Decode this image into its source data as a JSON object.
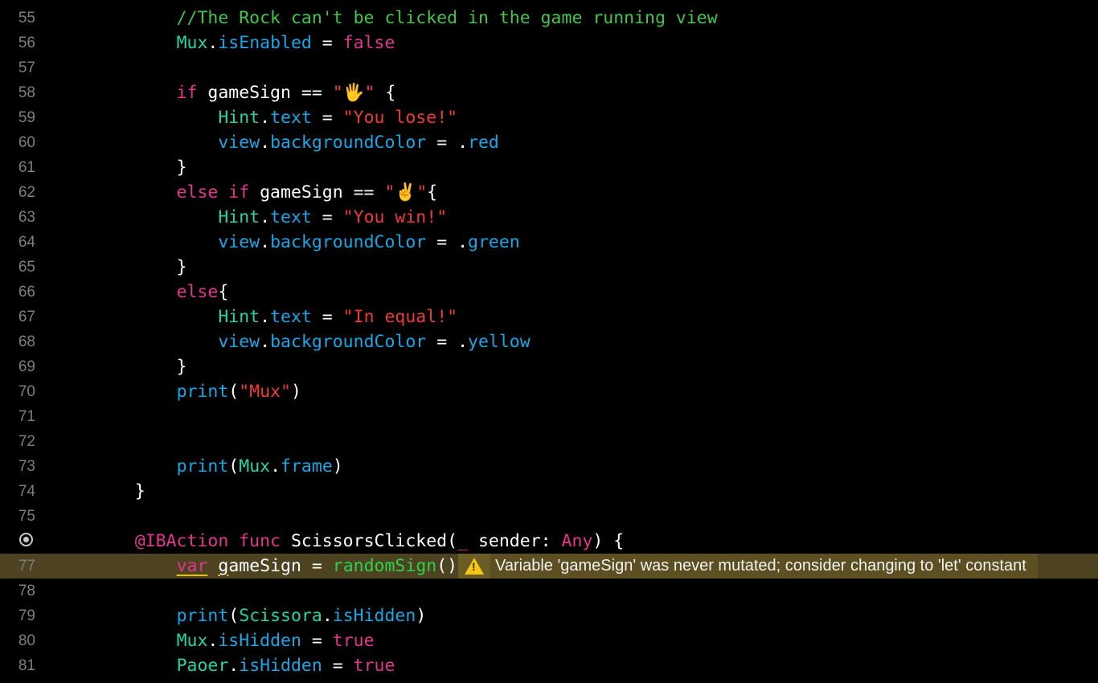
{
  "colors": {
    "background": "#000000",
    "line_number": "#7f7f7f",
    "comment": "#41c54a",
    "keyword": "#e3358f",
    "string": "#f03a39",
    "class_name": "#22d7a5",
    "property": "#15a8e8",
    "function_call": "#2bd14c",
    "plain": "#ffffff",
    "warning_line_background": "#4d4320",
    "warning_icon": "#f5c518"
  },
  "icons": {
    "breakpoint": "breakpoint-circle-icon",
    "warning": "warning-triangle-icon"
  },
  "lines": [
    {
      "num": "55",
      "tokens": [
        {
          "t": "        ",
          "k": "plain"
        },
        {
          "t": "//The Rock can't be clicked in the game running view",
          "k": "comment"
        }
      ]
    },
    {
      "num": "56",
      "tokens": [
        {
          "t": "        ",
          "k": "plain"
        },
        {
          "t": "Mux",
          "k": "class"
        },
        {
          "t": ".",
          "k": "plain"
        },
        {
          "t": "isEnabled",
          "k": "prop"
        },
        {
          "t": " = ",
          "k": "plain"
        },
        {
          "t": "false",
          "k": "keyword"
        }
      ]
    },
    {
      "num": "57",
      "tokens": []
    },
    {
      "num": "58",
      "tokens": [
        {
          "t": "        ",
          "k": "plain"
        },
        {
          "t": "if",
          "k": "keyword"
        },
        {
          "t": " gameSign == ",
          "k": "plain"
        },
        {
          "t": "\"",
          "k": "string"
        },
        {
          "t": "🖐",
          "k": "emoji"
        },
        {
          "t": "\"",
          "k": "string"
        },
        {
          "t": " {",
          "k": "plain"
        }
      ]
    },
    {
      "num": "59",
      "tokens": [
        {
          "t": "            ",
          "k": "plain"
        },
        {
          "t": "Hint",
          "k": "class"
        },
        {
          "t": ".",
          "k": "plain"
        },
        {
          "t": "text",
          "k": "prop"
        },
        {
          "t": " = ",
          "k": "plain"
        },
        {
          "t": "\"You lose!\"",
          "k": "string"
        }
      ]
    },
    {
      "num": "60",
      "tokens": [
        {
          "t": "            ",
          "k": "plain"
        },
        {
          "t": "view",
          "k": "prop"
        },
        {
          "t": ".",
          "k": "plain"
        },
        {
          "t": "backgroundColor",
          "k": "prop"
        },
        {
          "t": " = .",
          "k": "plain"
        },
        {
          "t": "red",
          "k": "prop"
        }
      ]
    },
    {
      "num": "61",
      "tokens": [
        {
          "t": "        }",
          "k": "plain"
        }
      ]
    },
    {
      "num": "62",
      "tokens": [
        {
          "t": "        ",
          "k": "plain"
        },
        {
          "t": "else if",
          "k": "keyword"
        },
        {
          "t": " gameSign == ",
          "k": "plain"
        },
        {
          "t": "\"",
          "k": "string"
        },
        {
          "t": "✌️",
          "k": "emoji"
        },
        {
          "t": "\"",
          "k": "string"
        },
        {
          "t": "{",
          "k": "plain"
        }
      ]
    },
    {
      "num": "63",
      "tokens": [
        {
          "t": "            ",
          "k": "plain"
        },
        {
          "t": "Hint",
          "k": "class"
        },
        {
          "t": ".",
          "k": "plain"
        },
        {
          "t": "text",
          "k": "prop"
        },
        {
          "t": " = ",
          "k": "plain"
        },
        {
          "t": "\"You win!\"",
          "k": "string"
        }
      ]
    },
    {
      "num": "64",
      "tokens": [
        {
          "t": "            ",
          "k": "plain"
        },
        {
          "t": "view",
          "k": "prop"
        },
        {
          "t": ".",
          "k": "plain"
        },
        {
          "t": "backgroundColor",
          "k": "prop"
        },
        {
          "t": " = .",
          "k": "plain"
        },
        {
          "t": "green",
          "k": "prop"
        }
      ]
    },
    {
      "num": "65",
      "tokens": [
        {
          "t": "        }",
          "k": "plain"
        }
      ]
    },
    {
      "num": "66",
      "tokens": [
        {
          "t": "        ",
          "k": "plain"
        },
        {
          "t": "else",
          "k": "keyword"
        },
        {
          "t": "{",
          "k": "plain"
        }
      ]
    },
    {
      "num": "67",
      "tokens": [
        {
          "t": "            ",
          "k": "plain"
        },
        {
          "t": "Hint",
          "k": "class"
        },
        {
          "t": ".",
          "k": "plain"
        },
        {
          "t": "text",
          "k": "prop"
        },
        {
          "t": " = ",
          "k": "plain"
        },
        {
          "t": "\"In equal!\"",
          "k": "string"
        }
      ]
    },
    {
      "num": "68",
      "tokens": [
        {
          "t": "            ",
          "k": "plain"
        },
        {
          "t": "view",
          "k": "prop"
        },
        {
          "t": ".",
          "k": "plain"
        },
        {
          "t": "backgroundColor",
          "k": "prop"
        },
        {
          "t": " = .",
          "k": "plain"
        },
        {
          "t": "yellow",
          "k": "prop"
        }
      ]
    },
    {
      "num": "69",
      "tokens": [
        {
          "t": "        }",
          "k": "plain"
        }
      ]
    },
    {
      "num": "70",
      "tokens": [
        {
          "t": "        ",
          "k": "plain"
        },
        {
          "t": "print",
          "k": "prop"
        },
        {
          "t": "(",
          "k": "plain"
        },
        {
          "t": "\"Mux\"",
          "k": "string"
        },
        {
          "t": ")",
          "k": "plain"
        }
      ]
    },
    {
      "num": "71",
      "tokens": []
    },
    {
      "num": "72",
      "tokens": []
    },
    {
      "num": "73",
      "tokens": [
        {
          "t": "        ",
          "k": "plain"
        },
        {
          "t": "print",
          "k": "prop"
        },
        {
          "t": "(",
          "k": "plain"
        },
        {
          "t": "Mux",
          "k": "class"
        },
        {
          "t": ".",
          "k": "plain"
        },
        {
          "t": "frame",
          "k": "prop"
        },
        {
          "t": ")",
          "k": "plain"
        }
      ]
    },
    {
      "num": "74",
      "tokens": [
        {
          "t": "    }",
          "k": "plain"
        }
      ]
    },
    {
      "num": "75",
      "tokens": []
    },
    {
      "num": "",
      "breakpoint": true,
      "tokens": [
        {
          "t": "    ",
          "k": "plain"
        },
        {
          "t": "@IBAction",
          "k": "keyword"
        },
        {
          "t": " ",
          "k": "plain"
        },
        {
          "t": "func",
          "k": "keyword"
        },
        {
          "t": " ScissorsClicked(",
          "k": "plain"
        },
        {
          "t": "_",
          "k": "keyword"
        },
        {
          "t": " sender: ",
          "k": "plain"
        },
        {
          "t": "Any",
          "k": "keyword"
        },
        {
          "t": ") {",
          "k": "plain"
        }
      ]
    },
    {
      "num": "77",
      "warning": true,
      "tokens": [
        {
          "t": "        ",
          "k": "plain"
        },
        {
          "t": "var",
          "k": "keyword",
          "u": true
        },
        {
          "t": " ",
          "k": "plain"
        },
        {
          "t": "g",
          "k": "plain",
          "u": true
        },
        {
          "t": "ameSign = ",
          "k": "plain"
        },
        {
          "t": "randomSign",
          "k": "func"
        },
        {
          "t": "()",
          "k": "plain"
        }
      ]
    },
    {
      "num": "78",
      "tokens": []
    },
    {
      "num": "79",
      "tokens": [
        {
          "t": "        ",
          "k": "plain"
        },
        {
          "t": "print",
          "k": "prop"
        },
        {
          "t": "(",
          "k": "plain"
        },
        {
          "t": "Scissora",
          "k": "class"
        },
        {
          "t": ".",
          "k": "plain"
        },
        {
          "t": "isHidden",
          "k": "prop"
        },
        {
          "t": ")",
          "k": "plain"
        }
      ]
    },
    {
      "num": "80",
      "tokens": [
        {
          "t": "        ",
          "k": "plain"
        },
        {
          "t": "Mux",
          "k": "class"
        },
        {
          "t": ".",
          "k": "plain"
        },
        {
          "t": "isHidden",
          "k": "prop"
        },
        {
          "t": " = ",
          "k": "plain"
        },
        {
          "t": "true",
          "k": "keyword"
        }
      ]
    },
    {
      "num": "81",
      "tokens": [
        {
          "t": "        ",
          "k": "plain"
        },
        {
          "t": "Paoer",
          "k": "class"
        },
        {
          "t": ".",
          "k": "plain"
        },
        {
          "t": "isHidden",
          "k": "prop"
        },
        {
          "t": " = ",
          "k": "plain"
        },
        {
          "t": "true",
          "k": "keyword"
        }
      ]
    }
  ],
  "warning": {
    "message": "Variable 'gameSign' was never mutated; consider changing to 'let' constant"
  }
}
